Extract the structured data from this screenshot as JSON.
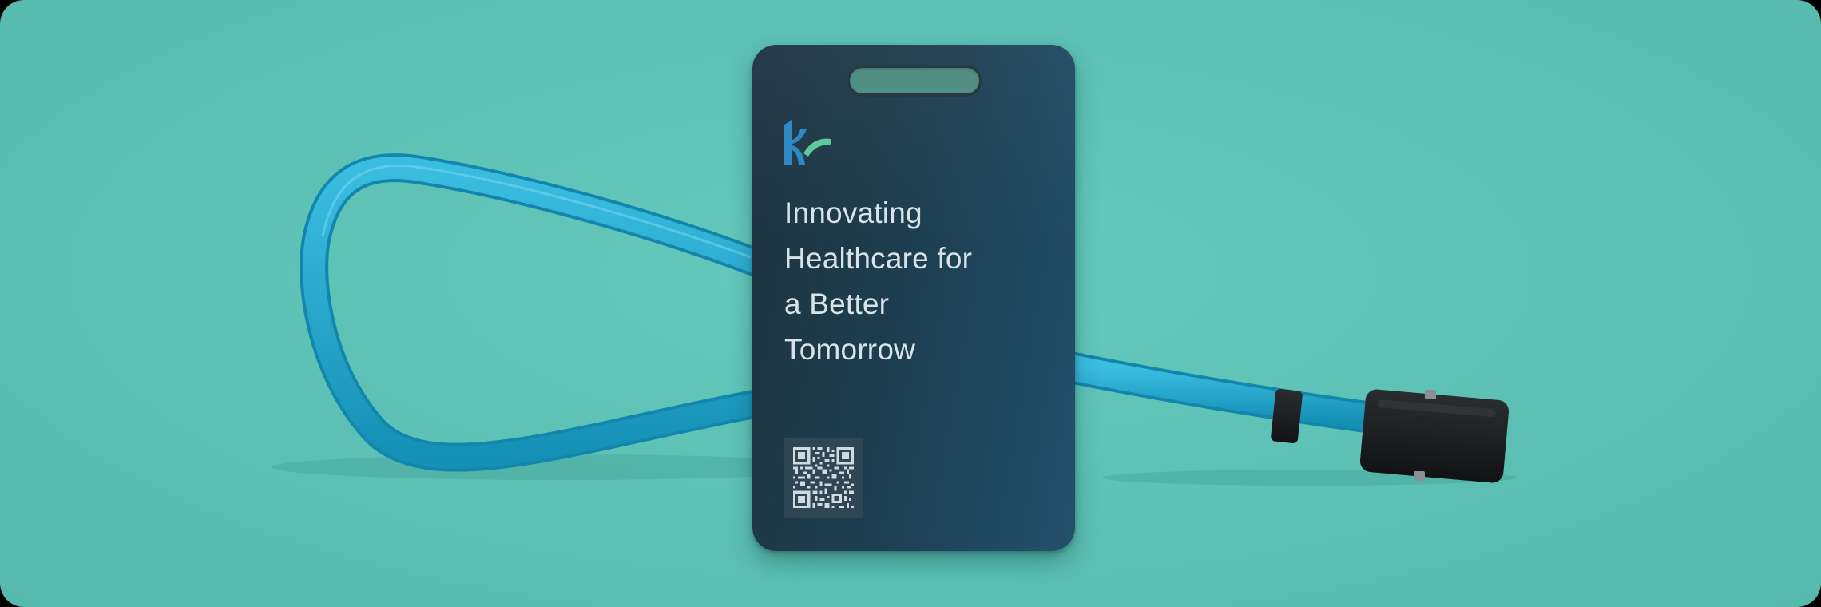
{
  "scene": {
    "background_color": "#5ec2b6",
    "lanyard_color": "#1fa3c9",
    "clip_color": "#1a1c1e"
  },
  "badge": {
    "background_color": "#1e3a4c",
    "tagline_lines": [
      "Innovating",
      "Healthcare for",
      "a Better",
      "Tomorrow"
    ],
    "logo_icon": "brand-logo-icon",
    "qr_icon": "qr-code-icon"
  }
}
